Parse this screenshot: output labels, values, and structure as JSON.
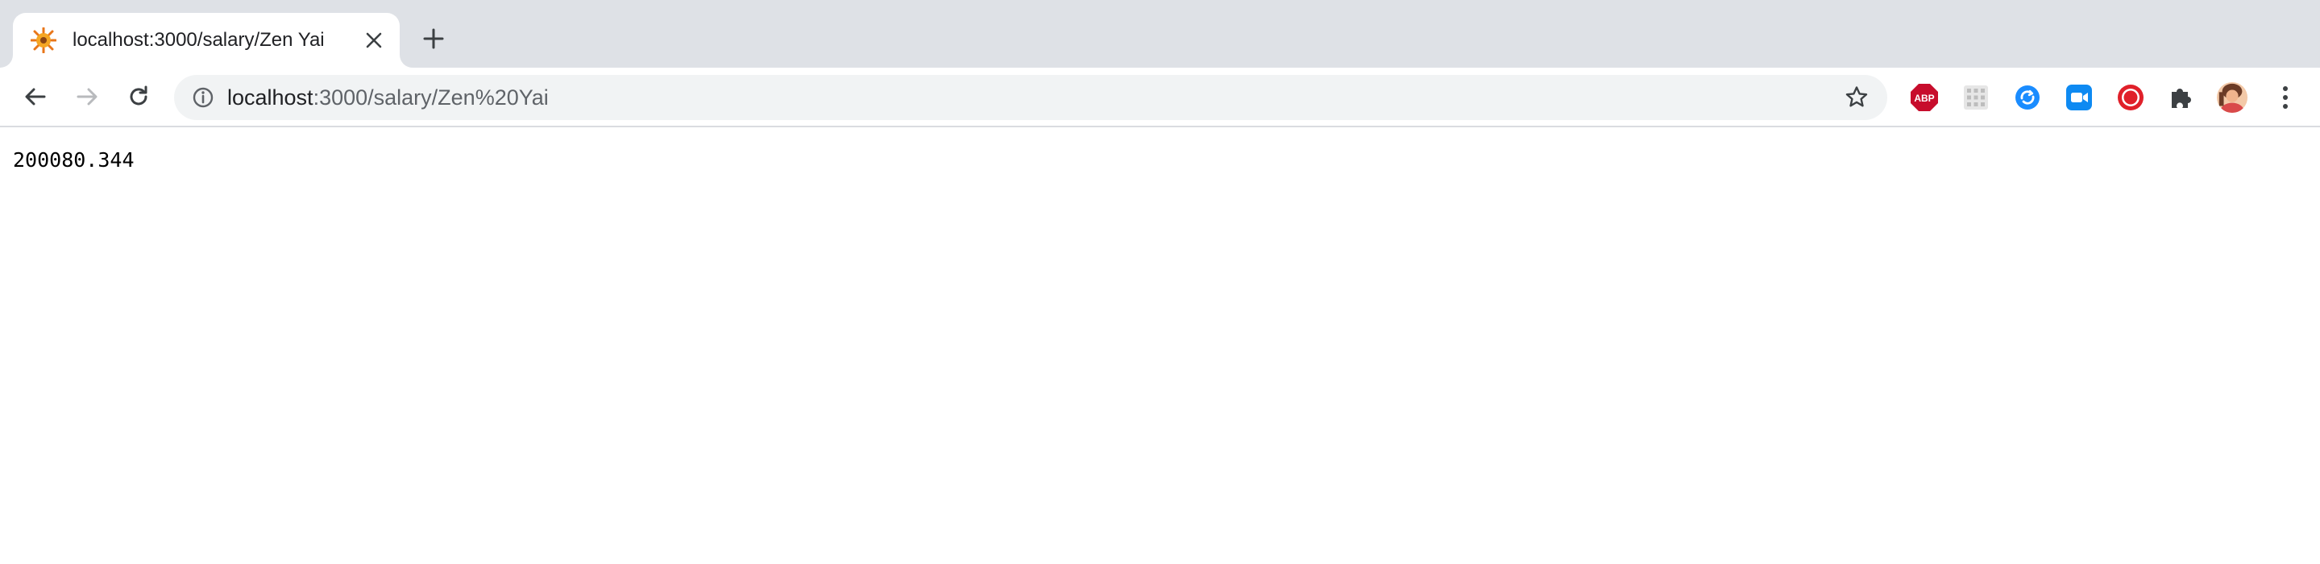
{
  "tab": {
    "title": "localhost:3000/salary/Zen Yai",
    "favicon": "sun-flower-favicon-icon"
  },
  "toolbar": {
    "url_host": "localhost",
    "url_path": ":3000/salary/Zen%20Yai",
    "icons": {
      "back": "arrow-left-icon",
      "forward": "arrow-right-icon",
      "reload": "reload-icon",
      "info": "info-icon",
      "bookmark": "star-outline-icon",
      "new_tab": "plus-icon",
      "close_tab": "close-icon"
    }
  },
  "extensions": {
    "adblock_label": "ABP",
    "items": [
      "adblock-plus-icon",
      "grid-extension-icon",
      "sync-extension-icon",
      "zoom-extension-icon",
      "record-extension-icon",
      "puzzle-icon",
      "profile-avatar",
      "kebab-menu-icon"
    ]
  },
  "page": {
    "body_text": "200080.344"
  },
  "colors": {
    "tab_strip": "#dee1e6",
    "omnibox": "#f1f3f4",
    "adblock": "#c70d2c",
    "sync": "#1a8cff",
    "zoom": "#0e8af2",
    "record": "#e0202a"
  }
}
